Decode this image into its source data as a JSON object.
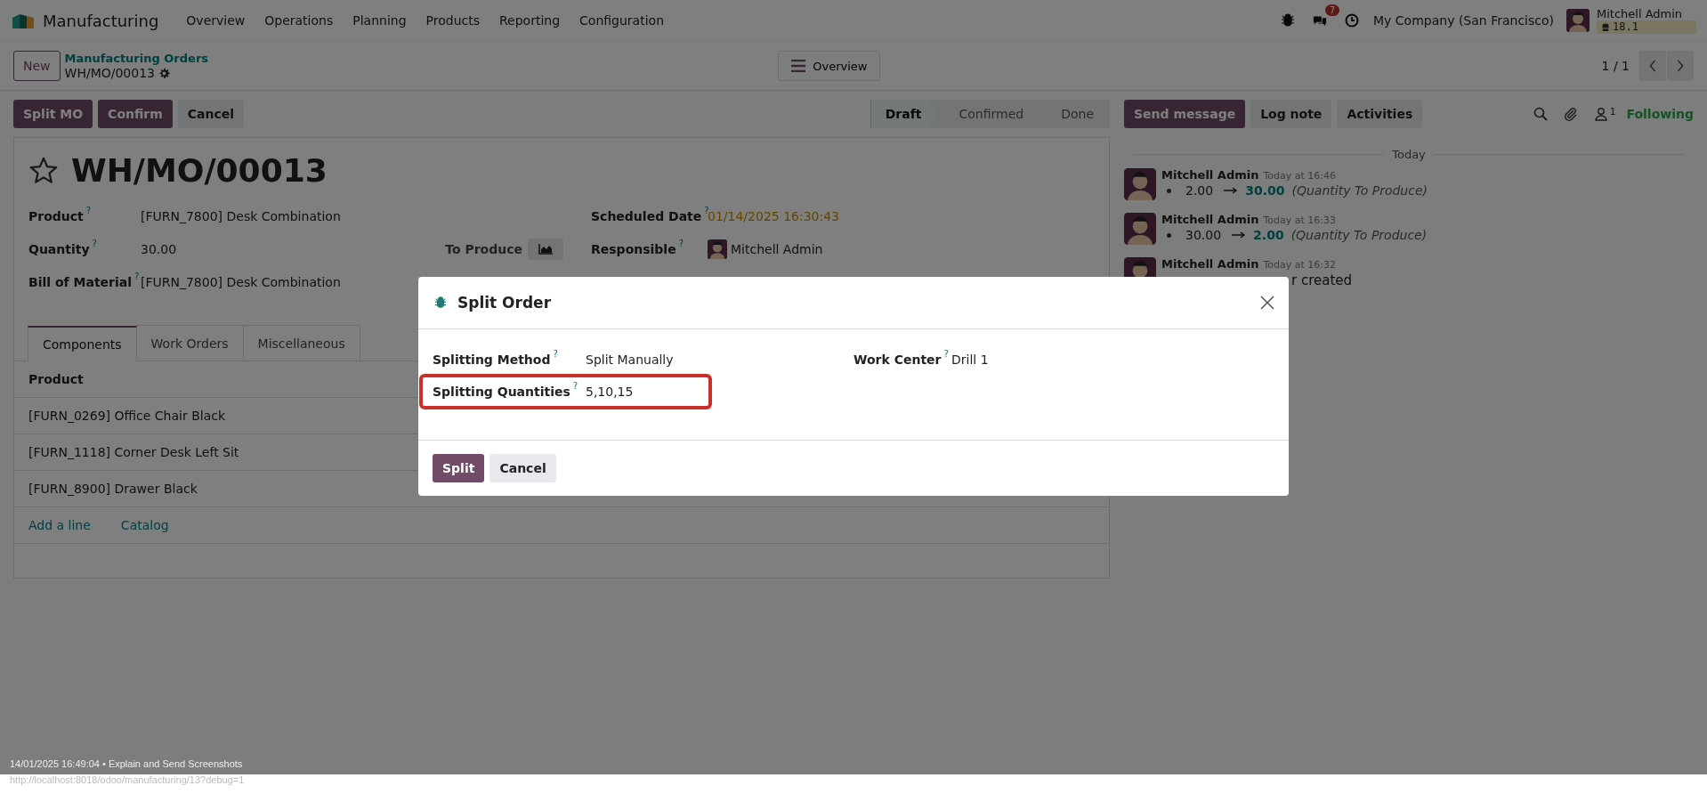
{
  "navbar": {
    "app": "Manufacturing",
    "menus": [
      "Overview",
      "Operations",
      "Planning",
      "Products",
      "Reporting",
      "Configuration"
    ],
    "chat_badge": "7",
    "company": "My Company (San Francisco)",
    "user": "Mitchell Admin",
    "db_version": "18.1"
  },
  "control_panel": {
    "new_button": "New",
    "breadcrumb": "Manufacturing Orders",
    "record": "WH/MO/00013",
    "view_button": "Overview",
    "pager": "1 / 1"
  },
  "actions": [
    {
      "label": "Split MO",
      "kind": "primary"
    },
    {
      "label": "Confirm",
      "kind": "primary"
    },
    {
      "label": "Cancel",
      "kind": "secondary"
    }
  ],
  "statusbar": [
    {
      "label": "Draft",
      "selected": true
    },
    {
      "label": "Confirmed",
      "selected": false
    },
    {
      "label": "Done",
      "selected": false
    }
  ],
  "form": {
    "starred": false,
    "title": "WH/MO/00013",
    "left_fields": [
      {
        "label": "Product",
        "help": "?",
        "value": "[FURN_7800] Desk Combination"
      },
      {
        "label": "Quantity",
        "help": "?",
        "value": "30.00",
        "side_button": "To Produce"
      },
      {
        "label": "Bill of Material",
        "help": "?",
        "value": "[FURN_7800] Desk Combination"
      }
    ],
    "right_fields": [
      {
        "label": "Scheduled Date",
        "help": "?",
        "value": "01/14/2025 16:30:43",
        "warning": true
      },
      {
        "label": "Responsible",
        "help": "?",
        "value": "Mitchell Admin",
        "avatar": true
      }
    ],
    "tabs": [
      {
        "label": "Components",
        "selected": true
      },
      {
        "label": "Work Orders",
        "selected": false
      },
      {
        "label": "Miscellaneous",
        "selected": false
      }
    ],
    "table": {
      "columns": [
        "Product"
      ],
      "rows": [
        "[FURN_0269] Office Chair Black",
        "[FURN_1118] Corner Desk Left Sit",
        "[FURN_8900] Drawer Black"
      ],
      "links": [
        "Add a line",
        "Catalog"
      ]
    }
  },
  "chatter": {
    "buttons": [
      {
        "label": "Send message",
        "kind": "primary"
      },
      {
        "label": "Log note",
        "kind": "secondary"
      },
      {
        "label": "Activities",
        "kind": "secondary"
      }
    ],
    "followers_count": "1",
    "follow": "Following",
    "date_separator": "Today",
    "messages": [
      {
        "kind": "tracking",
        "author": "Mitchell Admin",
        "time": "Today at 16:46",
        "old": "2.00",
        "new": "30.00",
        "field": "(Quantity To Produce)"
      },
      {
        "kind": "tracking",
        "author": "Mitchell Admin",
        "time": "Today at 16:33",
        "old": "30.00",
        "new": "2.00",
        "field": "(Quantity To Produce)"
      },
      {
        "kind": "note",
        "author": "Mitchell Admin",
        "time": "Today at 16:32",
        "body": "r created"
      }
    ]
  },
  "dialog": {
    "title": "Split Order",
    "left_fields": [
      {
        "label": "Splitting Method",
        "help": "?",
        "value": "Split Manually",
        "highlighted": false
      },
      {
        "label": "Splitting Quantities",
        "help": "?",
        "value": "5,10,15",
        "highlighted": true
      }
    ],
    "right_fields": [
      {
        "label": "Work Center",
        "help": "?",
        "value": "Drill 1",
        "highlighted": false
      }
    ],
    "buttons": [
      {
        "label": "Split",
        "kind": "primary"
      },
      {
        "label": "Cancel",
        "kind": "secondary"
      }
    ]
  },
  "footer": {
    "caption": "14/01/2025 16:49:04 • Explain and Send Screenshots",
    "url": "http://localhost:8018/odoo/manufacturing/13?debug=1"
  }
}
